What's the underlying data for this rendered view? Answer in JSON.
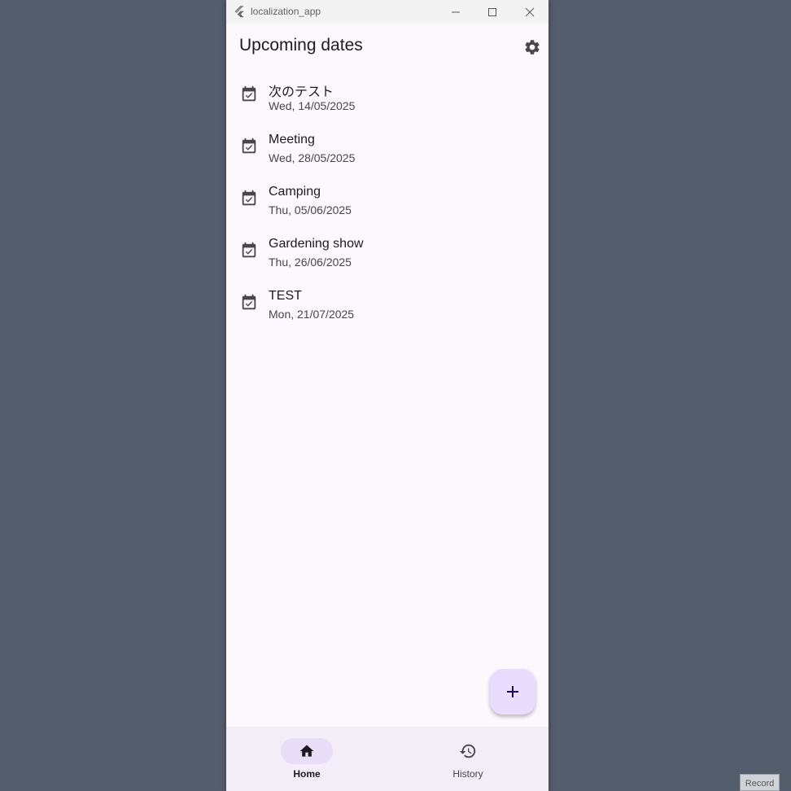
{
  "window": {
    "title": "localization_app",
    "controls": {
      "minimize_icon": "minimize-icon",
      "maximize_icon": "maximize-icon",
      "close_icon": "close-icon"
    }
  },
  "appbar": {
    "title": "Upcoming dates",
    "settings_icon": "gear-icon"
  },
  "events": [
    {
      "title": "次のテスト",
      "date": "Wed, 14/05/2025",
      "icon": "event-available-icon"
    },
    {
      "title": "Meeting",
      "date": "Wed, 28/05/2025",
      "icon": "event-available-icon"
    },
    {
      "title": "Camping",
      "date": "Thu, 05/06/2025",
      "icon": "event-available-icon"
    },
    {
      "title": "Gardening show",
      "date": "Thu, 26/06/2025",
      "icon": "event-available-icon"
    },
    {
      "title": "TEST",
      "date": "Mon, 21/07/2025",
      "icon": "event-available-icon"
    }
  ],
  "fab": {
    "icon": "plus-icon"
  },
  "bottom_nav": {
    "items": [
      {
        "label": "Home",
        "icon": "home-icon",
        "active": true
      },
      {
        "label": "History",
        "icon": "history-icon",
        "active": false
      }
    ]
  },
  "overlay": {
    "record_label": "Record"
  },
  "colors": {
    "desktop_bg": "#535d6b",
    "surface": "#fdf7fe",
    "nav_bg": "#f3edf7",
    "indicator": "#e8def8",
    "fab_bg": "#e9ddff",
    "text_primary": "#1d1b20",
    "text_secondary": "#49454f"
  }
}
